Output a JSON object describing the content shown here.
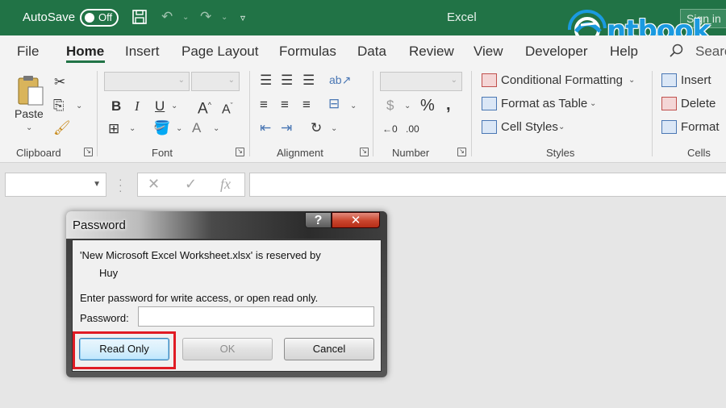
{
  "titlebar": {
    "autosave_label": "AutoSave",
    "autosave_state": "Off",
    "app_title": "Excel",
    "signin_label": "Sign in"
  },
  "logo": {
    "brand_text": "ntbook"
  },
  "tabs": [
    {
      "label": "File"
    },
    {
      "label": "Home",
      "active": true
    },
    {
      "label": "Insert"
    },
    {
      "label": "Page Layout"
    },
    {
      "label": "Formulas"
    },
    {
      "label": "Data"
    },
    {
      "label": "Review"
    },
    {
      "label": "View"
    },
    {
      "label": "Developer"
    },
    {
      "label": "Help"
    }
  ],
  "search_label": "Search",
  "ribbon": {
    "clipboard": {
      "label": "Clipboard",
      "paste_label": "Paste"
    },
    "font": {
      "label": "Font",
      "bold": "B",
      "italic": "I",
      "underline": "U"
    },
    "alignment": {
      "label": "Alignment"
    },
    "number": {
      "label": "Number",
      "currency": "$",
      "percent": "%"
    },
    "styles": {
      "label": "Styles",
      "conditional_formatting": "Conditional Formatting",
      "format_as_table": "Format as Table",
      "cell_styles": "Cell Styles"
    },
    "cells": {
      "label": "Cells",
      "insert": "Insert",
      "delete": "Delete",
      "format": "Format"
    }
  },
  "formula_bar": {
    "fx": "fx"
  },
  "dialog": {
    "title": "Password",
    "help_glyph": "?",
    "close_glyph": "✕",
    "message_line1": "'New Microsoft Excel Worksheet.xlsx' is reserved by",
    "reserved_by": "Huy",
    "message_line2": "Enter password for write access, or open read only.",
    "password_label": "Password:",
    "password_value": "",
    "buttons": {
      "read_only": "Read Only",
      "ok": "OK",
      "cancel": "Cancel"
    }
  },
  "colors": {
    "excel_green": "#217346",
    "highlight_red": "#e01b24"
  }
}
